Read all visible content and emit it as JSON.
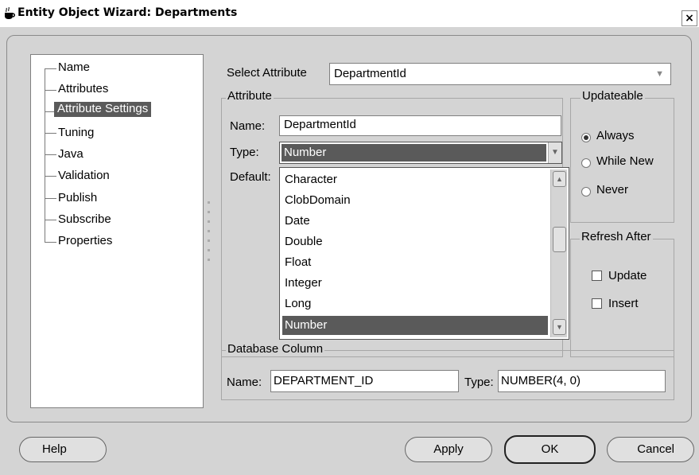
{
  "window": {
    "title": "Entity Object Wizard: Departments",
    "close_label": "×"
  },
  "tree": {
    "items": [
      {
        "label": "Name"
      },
      {
        "label": "Attributes"
      },
      {
        "label": "Attribute Settings",
        "selected": true
      },
      {
        "label": "Tuning"
      },
      {
        "label": "Java"
      },
      {
        "label": "Validation"
      },
      {
        "label": "Publish"
      },
      {
        "label": "Subscribe"
      },
      {
        "label": "Properties"
      }
    ]
  },
  "select_attribute": {
    "label": "Select Attribute",
    "value": "DepartmentId"
  },
  "attribute_group": {
    "legend": "Attribute",
    "name_label": "Name:",
    "name_value": "DepartmentId",
    "type_label": "Type:",
    "type_value": "Number",
    "default_label": "Default:"
  },
  "type_dropdown": {
    "options": [
      "Character",
      "ClobDomain",
      "Date",
      "Double",
      "Float",
      "Integer",
      "Long",
      "Number"
    ],
    "selected": "Number"
  },
  "updateable": {
    "legend": "Updateable",
    "options": [
      {
        "label": "Always",
        "checked": true
      },
      {
        "label": "While New",
        "checked": false
      },
      {
        "label": "Never",
        "checked": false
      }
    ]
  },
  "refresh_after": {
    "legend": "Refresh After",
    "options": [
      {
        "label": "Update",
        "checked": false
      },
      {
        "label": "Insert",
        "checked": false
      }
    ]
  },
  "database_column": {
    "legend": "Database Column",
    "name_label": "Name:",
    "name_value": "DEPARTMENT_ID",
    "type_label": "Type:",
    "type_value": "NUMBER(4, 0)"
  },
  "buttons": {
    "help": "Help",
    "apply": "Apply",
    "ok": "OK",
    "cancel": "Cancel"
  },
  "icons": {
    "window": "coffee-cup-icon",
    "dropdown": "chevron-down-icon"
  }
}
